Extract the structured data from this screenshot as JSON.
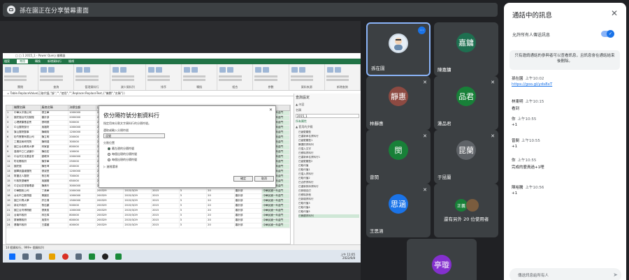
{
  "banner": {
    "text": "孫在園正在分享螢幕畫面"
  },
  "excel": {
    "title": "□ □ 1 2015_1 - Power Query 編輯器",
    "tabs": [
      "檔案",
      "常用",
      "轉換",
      "新增資料行",
      "檢視"
    ],
    "ribbon_groups": [
      "關閉",
      "查詢",
      "管理資料行",
      "減少資料列",
      "排序",
      "轉換",
      "組合",
      "參數",
      "資料來源",
      "新增查詢"
    ],
    "formula": "= Table.ReplaceValue(已取代值,\"錄\",\"\",\"使用\",\"\",Replacer.ReplaceText,{\"機關\",\"名稱\"})",
    "headers": [
      "機關名稱",
      "廠商名稱",
      "決標金額",
      "日期",
      "日期2",
      "年",
      "月",
      "案號",
      "單位",
      "類別"
    ],
    "rows": [
      [
        "1",
        "中華大平鎮公司",
        "張玉華",
        "1000000",
        "200329",
        "2015/3/29",
        "2015",
        "3",
        "20",
        "審計部",
        "中華民國一年金門"
      ],
      [
        "2",
        "國史館台灣文獻館",
        "審計部",
        "2000000",
        "200329",
        "2015/3/29",
        "2015",
        "3",
        "20",
        "審計部",
        "中華民國一年金門"
      ],
      [
        "3",
        "心理健康基金會",
        "張明德",
        "500000",
        "200329",
        "2015/3/29",
        "2015",
        "3",
        "20",
        "審計部",
        "中華民國一年金門"
      ],
      [
        "4",
        "中山醫院部分",
        "吳福財",
        "1000000",
        "200329",
        "2015/3/29",
        "2015",
        "3",
        "20",
        "審計部",
        "中華民國一年金門"
      ],
      [
        "5",
        "旗山醫院醫事",
        "陳朝貴",
        "1200000",
        "200329",
        "2015/3/29",
        "2015",
        "3",
        "20",
        "審計部",
        "中華民國一年金門"
      ],
      [
        "6",
        "松竹實業有限公司",
        "陳立明",
        "200000",
        "200329",
        "2015/3/29",
        "2015",
        "3",
        "20",
        "審計部",
        "中華民國一年金門"
      ],
      [
        "7",
        "工業技術研究院",
        "陳明達",
        "300000",
        "200329",
        "2015/3/29",
        "2015",
        "3",
        "20",
        "審計部",
        "中華民國一年金門"
      ],
      [
        "8",
        "國立台北教育大學",
        "林家豪",
        "800000",
        "200329",
        "2015/3/29",
        "2015",
        "3",
        "20",
        "審計部",
        "中華民國一年金門"
      ],
      [
        "9",
        "高雄市立仁武國中",
        "陳信宏",
        "100000",
        "200329",
        "2015/3/29",
        "2015",
        "3",
        "20",
        "審計部",
        "中華民國一年金門"
      ],
      [
        "10",
        "中台灣文化基金會",
        "劉曉萍",
        "2000000",
        "200329",
        "2015/3/29",
        "2015",
        "3",
        "20",
        "審計部",
        "中華民國一年金門"
      ],
      [
        "11",
        "彰化縣政府",
        "陳芳華",
        "250000",
        "200329",
        "2015/3/29",
        "2015",
        "3",
        "20",
        "審計部",
        "中華民國一年金門"
      ],
      [
        "12",
        "國史館",
        "陳世坤",
        "450000",
        "200329",
        "2015/3/29",
        "2015",
        "3",
        "20",
        "審計部",
        "中華民國一年金門"
      ],
      [
        "13",
        "國軍桃園總醫院",
        "張淑慧",
        "1200000",
        "200329",
        "2015/3/29",
        "2015",
        "3",
        "20",
        "審計部",
        "中華民國一年金門"
      ],
      [
        "14",
        "財團法人醫院",
        "蔡志明",
        "700000",
        "200329",
        "2015/3/29",
        "2015",
        "3",
        "20",
        "審計部",
        "中華民國一年金門"
      ],
      [
        "15",
        "行政院退輔會",
        "吳國權",
        "650000",
        "200329",
        "2015/3/29",
        "2015",
        "3",
        "20",
        "審計部",
        "中華民國一年金門"
      ],
      [
        "16",
        "中正紀念堂管理處",
        "陳美玲",
        "3000000",
        "200329",
        "2015/3/29",
        "2015",
        "3",
        "20",
        "審計部",
        "中華民國一年金門"
      ],
      [
        "17",
        "中華郵政公司",
        "丁美華",
        "2000000",
        "200329",
        "2015/3/29",
        "2015",
        "3",
        "20",
        "審計部",
        "中華民國一年金門"
      ],
      [
        "18",
        "台北市立動物園",
        "黃國忠",
        "1000000",
        "200329",
        "2015/3/29",
        "2015",
        "3",
        "20",
        "審計部",
        "中華民國一年金門"
      ],
      [
        "19",
        "國立中興大學",
        "許志清",
        "1500000",
        "200329",
        "2015/3/29",
        "2015",
        "3",
        "20",
        "審計部",
        "中華民國一年金門"
      ],
      [
        "20",
        "新北市政府",
        "蔡佳穎",
        "500000",
        "200329",
        "2015/3/29",
        "2015",
        "3",
        "20",
        "審計部",
        "中華民國一年金門"
      ],
      [
        "21",
        "國立台灣博物館",
        "張美惠",
        "1000000",
        "200329",
        "2015/3/29",
        "2015",
        "3",
        "20",
        "審計部",
        "中華民國一年金門"
      ],
      [
        "22",
        "台南市政府",
        "林志偉",
        "800000",
        "200329",
        "2015/3/29",
        "2015",
        "3",
        "20",
        "審計部",
        "中華民國一年金門"
      ],
      [
        "23",
        "屏東縣政府",
        "吳秀玲",
        "600000",
        "200329",
        "2015/3/29",
        "2015",
        "3",
        "20",
        "審計部",
        "中華民國一年金門"
      ],
      [
        "24",
        "基隆市政府",
        "王建國",
        "400000",
        "200329",
        "2015/3/29",
        "2015",
        "3",
        "20",
        "審計部",
        "中華民國一年金門"
      ]
    ],
    "query_panel": {
      "title": "查詢設定",
      "section1": "▲ 內容",
      "name_label": "名稱",
      "name_value": "2015_1",
      "all_props": "所有屬性",
      "section2": "▲ 套用的步驟",
      "steps": [
        "已變更類型",
        "已重新命名資料行",
        "已變更類型1",
        "篩選的資料列",
        "已插入文字",
        "已移除資料行",
        "已重新命名資料行1",
        "已變更類型2",
        "已取代值",
        "已取代值1",
        "已插入資料行",
        "已取代值2",
        "已合併資料行",
        "已重新排序資料行",
        "已新增自訂",
        "已移除其他",
        "已新增資料行",
        "已取代值3",
        "已取代值4",
        "已取代值5",
        "已篩選資料列"
      ]
    },
    "dialog": {
      "title": "依分隔符號分割資料行",
      "desc": "指定用來分割文字資料行的分隔符號。",
      "label1": "選取或輸入分隔符號",
      "select_value": "逗號",
      "label2": "分割位置",
      "opt1": "最左邊的分隔符號",
      "opt2": "每個出現的分隔符號",
      "opt3": "每個出現的分隔符號",
      "advanced": "▷ 進階選項",
      "ok": "確定",
      "cancel": "取消",
      "close": "✕"
    },
    "status": "14 個資料行、999+ 個資料列",
    "clock_time": "上午 11:05",
    "clock_date": "2022/6/8"
  },
  "tiles": [
    {
      "name": "孫在園",
      "active": true
    },
    {
      "name": "陳嘉鏞",
      "initials": "嘉鏞",
      "color": "#1e6f50"
    },
    {
      "name": "林靜惠",
      "initials": "靜惠",
      "color": "#8d4a42"
    },
    {
      "name": "蓮品君",
      "initials": "品君",
      "color": "#188038"
    },
    {
      "name": "曾閔",
      "initials": "閔",
      "color": "#188038"
    },
    {
      "name": "于昆蘭",
      "initials": "昆蘭",
      "color": "#5f6368"
    },
    {
      "name": "王思涵",
      "initials": "思涵",
      "color": "#1a73e8"
    },
    {
      "name": "還有另外 20 位使用者",
      "mini1": "正義",
      "mini1_color": "#188038"
    },
    {
      "initials": "亭璇",
      "color": "#8430ce"
    }
  ],
  "panel": {
    "title": "通話中的訊息",
    "close": "✕",
    "toggle_label": "允許所有人傳送訊息",
    "notice": "只有邀請通話的參與者可以查看訊息，且訊息會在通話結束後刪除。",
    "messages": [
      {
        "sender": "孫在園",
        "time": "上午10:02",
        "body": "https://goo.gl/yds8xT",
        "link": true
      },
      {
        "sender": "林東明",
        "time": "上午10:15",
        "body": "看到"
      },
      {
        "sender": "你",
        "time": "上午10:55",
        "body": "+1"
      },
      {
        "sender": "曾閔",
        "time": "上午10:55",
        "body": "+1"
      },
      {
        "sender": "你",
        "time": "上午10:55",
        "body": "完成的麼員過+1哩"
      },
      {
        "sender": "陳裕騰",
        "time": "上午10:56",
        "body": "+1"
      }
    ],
    "input_placeholder": "傳送訊息給所有人",
    "send_icon": "send-icon"
  },
  "colors": {
    "meet_bg": "#202124",
    "tile_bg": "#3c4043",
    "accent": "#1a73e8",
    "excel_green": "#217346"
  }
}
